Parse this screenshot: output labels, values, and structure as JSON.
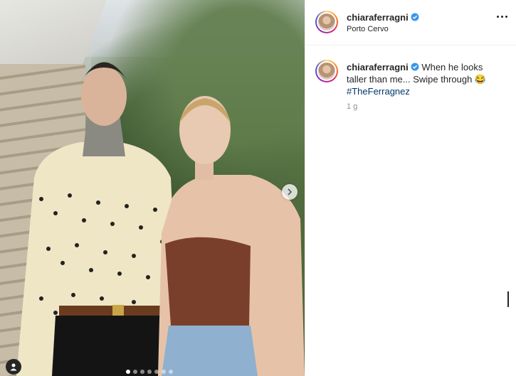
{
  "post": {
    "username": "chiaraferragni",
    "location": "Porto Cervo",
    "caption_text": "When he looks taller than me... Swipe through 😂",
    "hashtag": "#TheFerragnez",
    "time": "1 g",
    "carousel": {
      "total": 7,
      "current": 1
    }
  },
  "icons": {
    "verified": "verified-badge-icon",
    "more": "more-options-icon",
    "next": "chevron-right-icon",
    "tag": "person-tag-icon"
  },
  "colors": {
    "verified": "#3897f0",
    "hashtag": "#00376b",
    "secondary_text": "#8e8e8e"
  }
}
